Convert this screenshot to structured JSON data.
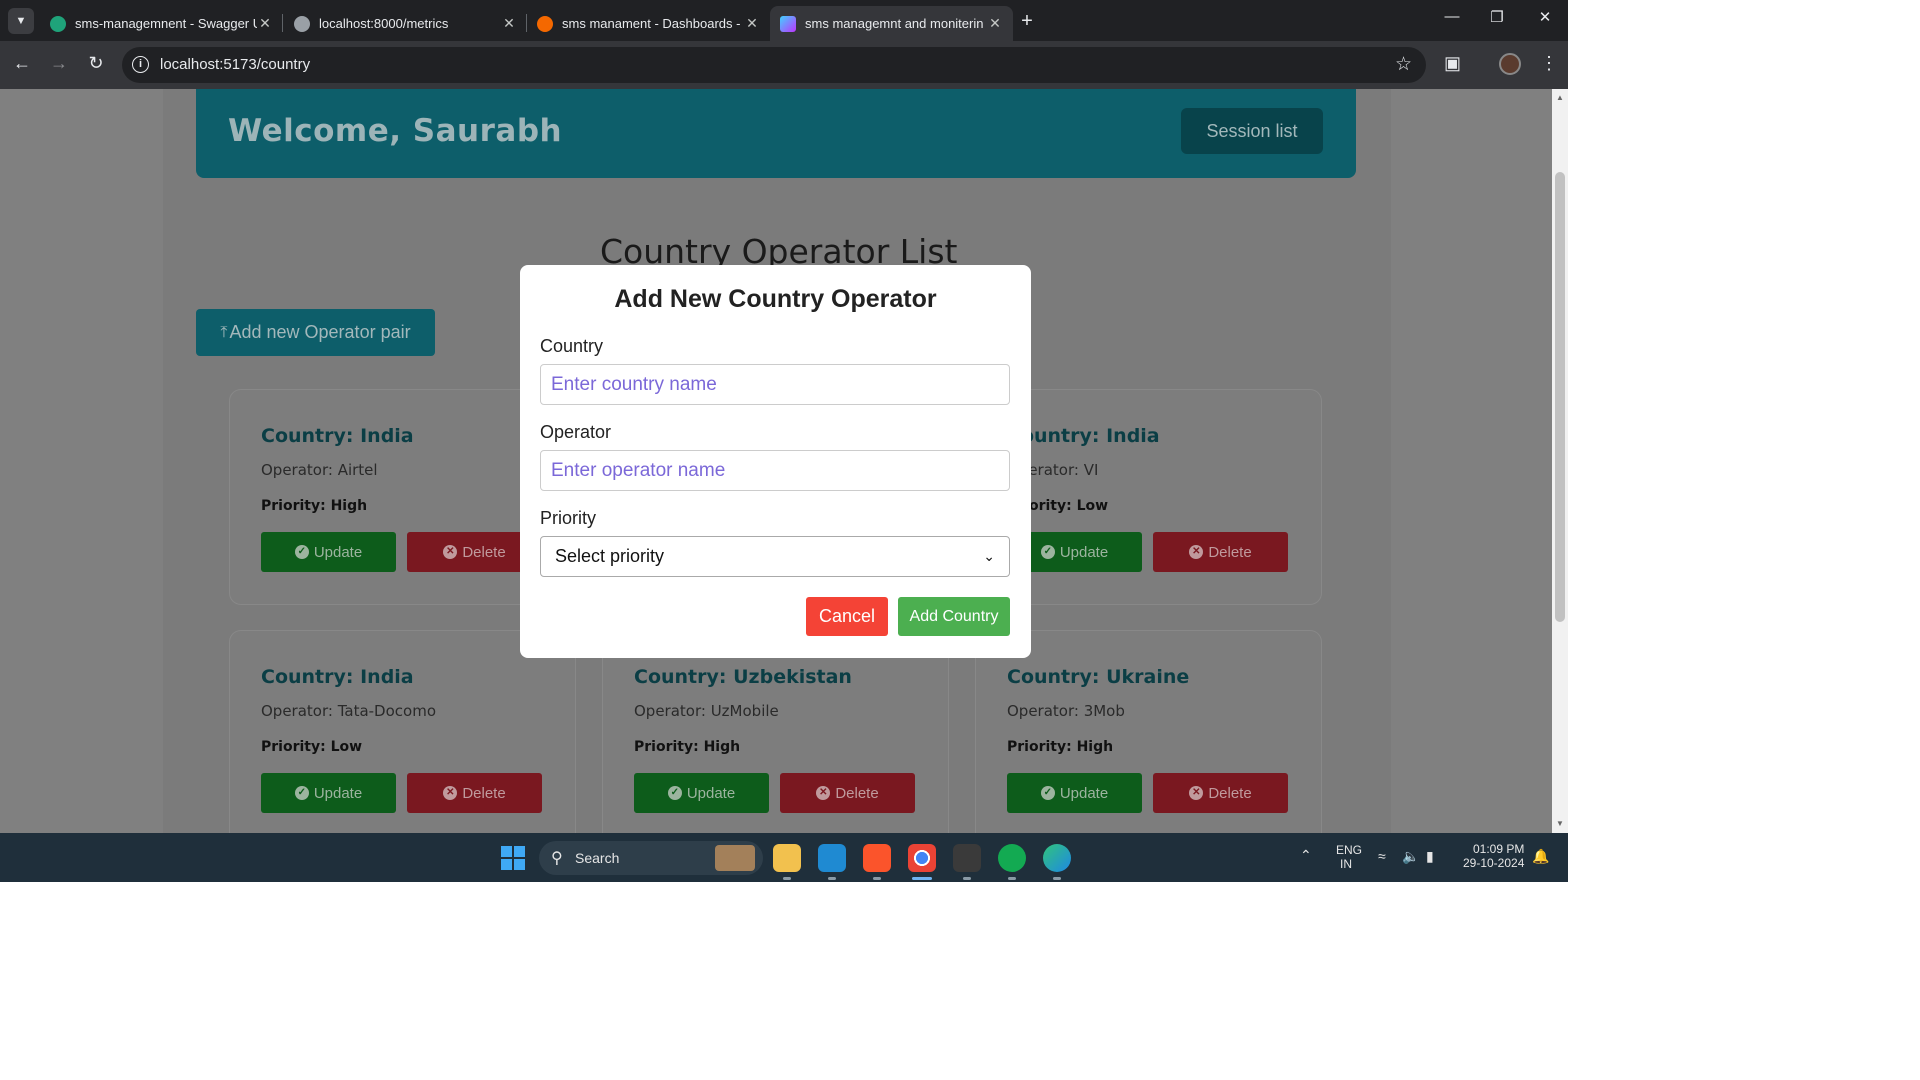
{
  "browser": {
    "tabs": [
      {
        "title": "sms-managemnent - Swagger U",
        "favicon": "swagger-icon",
        "active": false
      },
      {
        "title": "localhost:8000/metrics",
        "favicon": "globe-icon",
        "active": false
      },
      {
        "title": "sms manament - Dashboards - ",
        "favicon": "grafana-icon",
        "active": false
      },
      {
        "title": "sms managemnt and moniterin",
        "favicon": "vite-icon",
        "active": true
      }
    ],
    "url": "localhost:5173/country"
  },
  "header": {
    "welcome": "Welcome, Saurabh",
    "session_button": "Session list"
  },
  "page": {
    "title": "Country Operator List",
    "add_button": "Add new Operator pair"
  },
  "cards": [
    {
      "country": "Country: India",
      "operator": "Operator: Airtel",
      "priority": "Priority: High",
      "update": "Update",
      "delete": "Delete"
    },
    {
      "country": "Country: India",
      "operator": "Operator: VI",
      "priority": "Priority: Low",
      "update": "Update",
      "delete": "Delete"
    },
    {
      "country": "Country: India",
      "operator": "Operator: Tata-Docomo",
      "priority": "Priority: Low",
      "update": "Update",
      "delete": "Delete"
    },
    {
      "country": "Country: Uzbekistan",
      "operator": "Operator: UzMobile",
      "priority": "Priority: High",
      "update": "Update",
      "delete": "Delete"
    },
    {
      "country": "Country: Ukraine",
      "operator": "Operator: 3Mob",
      "priority": "Priority: High",
      "update": "Update",
      "delete": "Delete"
    }
  ],
  "modal": {
    "title": "Add New Country Operator",
    "country_label": "Country",
    "country_placeholder": "Enter country name",
    "operator_label": "Operator",
    "operator_placeholder": "Enter operator name",
    "priority_label": "Priority",
    "priority_selected": "Select priority",
    "cancel": "Cancel",
    "submit": "Add Country"
  },
  "taskbar": {
    "search": "Search",
    "lang_line1": "ENG",
    "lang_line2": "IN",
    "time": "01:09 PM",
    "date": "29-10-2024"
  }
}
